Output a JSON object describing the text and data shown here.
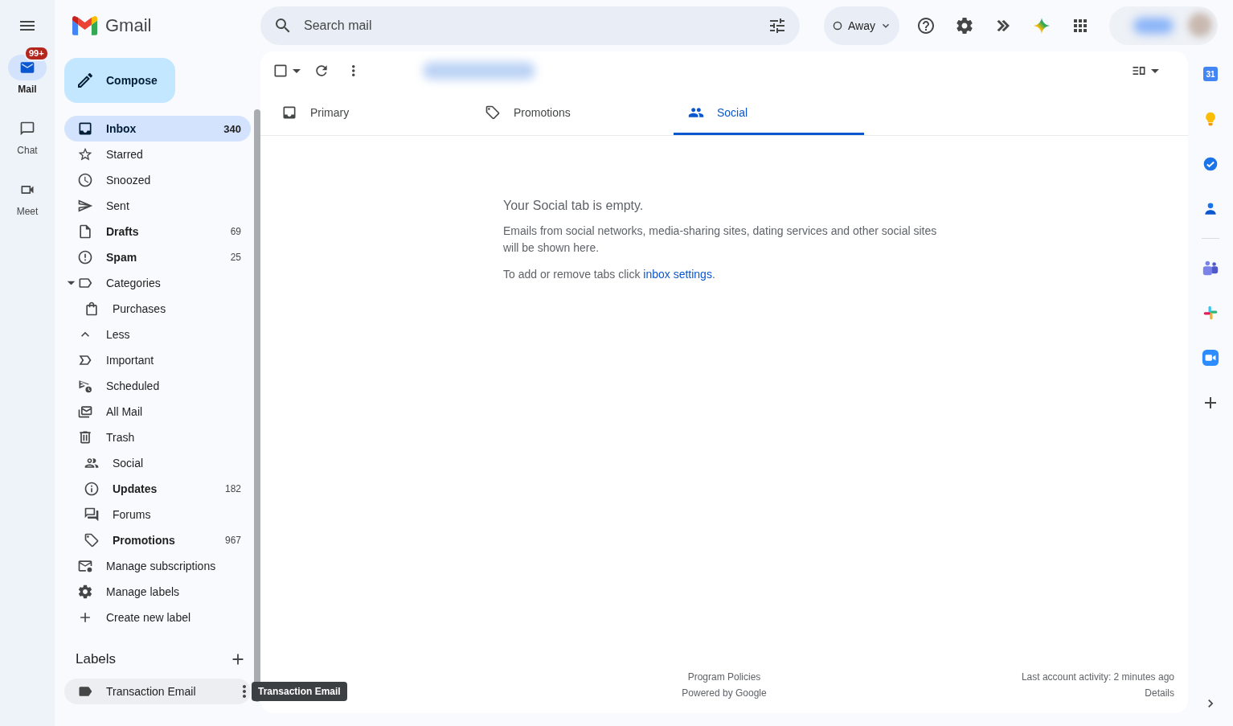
{
  "rail": {
    "items": [
      {
        "label": "Mail",
        "selected": true,
        "badge": "99+"
      },
      {
        "label": "Chat",
        "selected": false
      },
      {
        "label": "Meet",
        "selected": false
      }
    ]
  },
  "header": {
    "product": "Gmail",
    "search": {
      "placeholder": "Search mail"
    },
    "status": "Away"
  },
  "compose": "Compose",
  "nav": {
    "items": [
      {
        "kind": "folder",
        "label": "Inbox",
        "count": "340",
        "unread": true,
        "selected": true
      },
      {
        "kind": "folder",
        "label": "Starred",
        "unread": false,
        "selected": false
      },
      {
        "kind": "folder",
        "label": "Snoozed",
        "unread": false,
        "selected": false
      },
      {
        "kind": "folder",
        "label": "Sent",
        "unread": false,
        "selected": false
      },
      {
        "kind": "folder",
        "label": "Drafts",
        "count": "69",
        "unread": true,
        "selected": false
      },
      {
        "kind": "folder",
        "label": "Spam",
        "count": "25",
        "unread": true,
        "selected": false
      },
      {
        "kind": "group",
        "label": "Categories",
        "expanded": true,
        "unread": false,
        "selected": false
      },
      {
        "kind": "category",
        "label": "Purchases",
        "unread": false,
        "selected": false
      },
      {
        "kind": "folder",
        "label": "Less",
        "unread": false,
        "selected": false
      },
      {
        "kind": "folder",
        "label": "Important",
        "unread": false,
        "selected": false
      },
      {
        "kind": "folder",
        "label": "Scheduled",
        "unread": false,
        "selected": false
      },
      {
        "kind": "folder",
        "label": "All Mail",
        "unread": false,
        "selected": false
      },
      {
        "kind": "folder",
        "label": "Trash",
        "unread": false,
        "selected": false
      },
      {
        "kind": "category",
        "label": "Social",
        "unread": false,
        "selected": false
      },
      {
        "kind": "category",
        "label": "Updates",
        "count": "182",
        "unread": true,
        "selected": false
      },
      {
        "kind": "category",
        "label": "Forums",
        "unread": false,
        "selected": false
      },
      {
        "kind": "category",
        "label": "Promotions",
        "count": "967",
        "unread": true,
        "selected": false
      },
      {
        "kind": "folder",
        "label": "Manage subscriptions",
        "unread": false,
        "selected": false
      },
      {
        "kind": "folder",
        "label": "Manage labels",
        "unread": false,
        "selected": false
      },
      {
        "kind": "folder",
        "label": "Create new label",
        "unread": false,
        "selected": false
      }
    ]
  },
  "labels": {
    "title": "Labels",
    "items": [
      {
        "label": "Transaction Email",
        "hovered": true
      }
    ]
  },
  "tooltip": "Transaction Email",
  "tabs": [
    {
      "label": "Primary",
      "selected": false
    },
    {
      "label": "Promotions",
      "selected": false
    },
    {
      "label": "Social",
      "selected": true
    }
  ],
  "empty_state": {
    "title": "Your Social tab is empty.",
    "body": "Emails from social networks, media-sharing sites, dating services and other social sites will be shown here.",
    "hint": "To add or remove tabs click",
    "link": "inbox settings",
    "end": "."
  },
  "footer": {
    "policies": "Program Policies",
    "powered": "Powered by Google",
    "activity": "Last account activity: 2 minutes ago",
    "details": "Details"
  },
  "right_rail": {
    "calendar_date": "31"
  }
}
